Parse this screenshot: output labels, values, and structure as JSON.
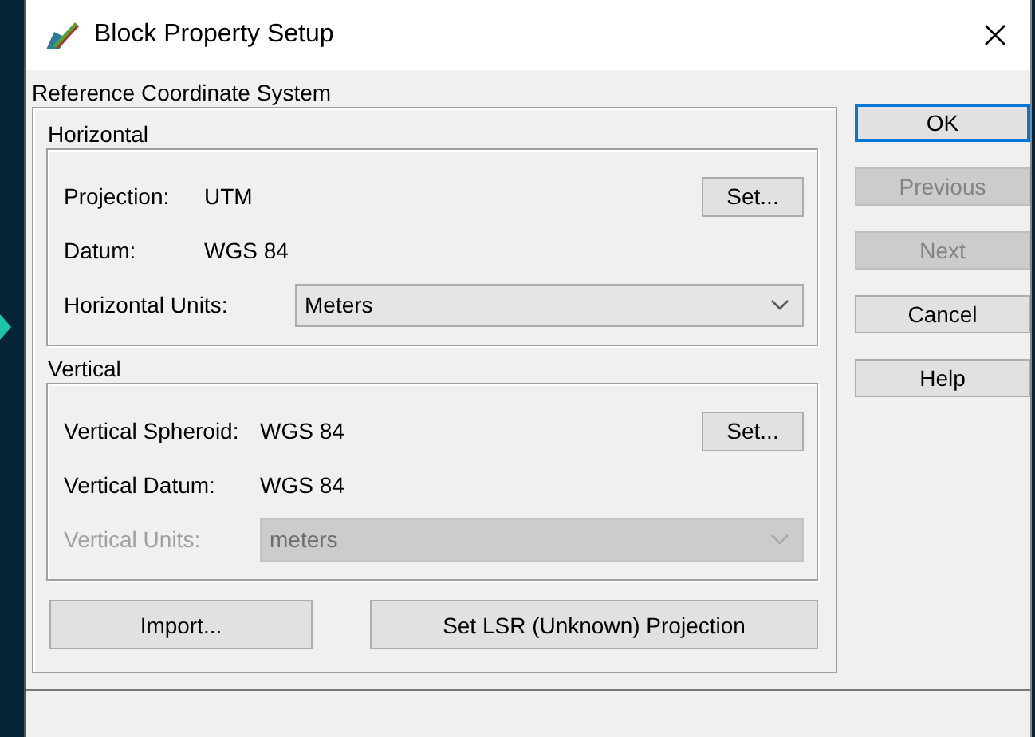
{
  "window": {
    "title": "Block Property Setup"
  },
  "reference": {
    "label": "Reference Coordinate System",
    "groups": [
      {
        "label": "Horizontal",
        "rows": [
          {
            "kind": "value",
            "label": "Projection:",
            "value": "UTM",
            "button": "Set..."
          },
          {
            "kind": "value",
            "label": "Datum:",
            "value": "WGS 84"
          },
          {
            "kind": "combo",
            "label": "Horizontal Units:",
            "value": "Meters",
            "disabled": false
          }
        ]
      },
      {
        "label": "Vertical",
        "rows": [
          {
            "kind": "value",
            "label": "Vertical Spheroid:",
            "value": "WGS 84",
            "button": "Set..."
          },
          {
            "kind": "value",
            "label": "Vertical Datum:",
            "value": "WGS 84"
          },
          {
            "kind": "combo",
            "label": "Vertical Units:",
            "value": "meters",
            "disabled": true
          }
        ]
      }
    ],
    "buttons": [
      {
        "label": "Import...",
        "disabled": false
      },
      {
        "label": "Set LSR (Unknown) Projection",
        "disabled": false
      }
    ]
  },
  "side_buttons": [
    {
      "label": "OK",
      "default": true,
      "disabled": false
    },
    {
      "label": "Previous",
      "default": false,
      "disabled": true
    },
    {
      "label": "Next",
      "default": false,
      "disabled": true
    },
    {
      "label": "Cancel",
      "default": false,
      "disabled": false
    },
    {
      "label": "Help",
      "default": false,
      "disabled": false
    }
  ]
}
